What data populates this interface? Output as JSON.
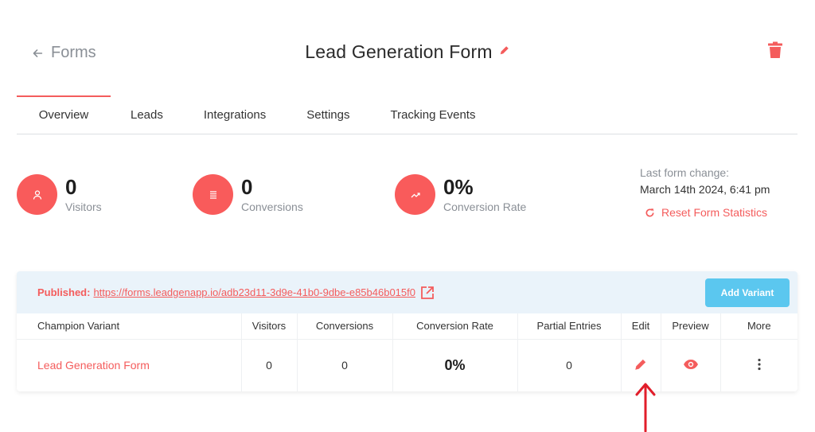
{
  "header": {
    "back_label": "Forms",
    "title": "Lead Generation Form"
  },
  "tabs": [
    {
      "label": "Overview",
      "active": true
    },
    {
      "label": "Leads",
      "active": false
    },
    {
      "label": "Integrations",
      "active": false
    },
    {
      "label": "Settings",
      "active": false
    },
    {
      "label": "Tracking Events",
      "active": false
    }
  ],
  "stats": [
    {
      "value": "0",
      "label": "Visitors",
      "icon": "user-icon"
    },
    {
      "value": "0",
      "label": "Conversions",
      "icon": "list-icon"
    },
    {
      "value": "0%",
      "label": "Conversion Rate",
      "icon": "trending-up-icon"
    }
  ],
  "last_change": {
    "label": "Last form change:",
    "value": "March 14th 2024, 6:41 pm",
    "reset_label": "Reset Form Statistics"
  },
  "published": {
    "label": "Published:",
    "url": "https://forms.leadgenapp.io/adb23d11-3d9e-41b0-9dbe-e85b46b015f0",
    "add_variant_label": "Add Variant"
  },
  "table": {
    "headers": [
      "Champion Variant",
      "Visitors",
      "Conversions",
      "Conversion Rate",
      "Partial Entries",
      "Edit",
      "Preview",
      "More"
    ],
    "rows": [
      {
        "name": "Lead Generation Form",
        "visitors": "0",
        "conversions": "0",
        "conversion_rate": "0%",
        "partial_entries": "0"
      }
    ]
  },
  "colors": {
    "accent": "#f45c5c",
    "stat_circle": "#f95b5b",
    "button": "#5bc7ef",
    "published_bg": "#eaf3fa",
    "annotation_arrow": "#e11d2a"
  }
}
